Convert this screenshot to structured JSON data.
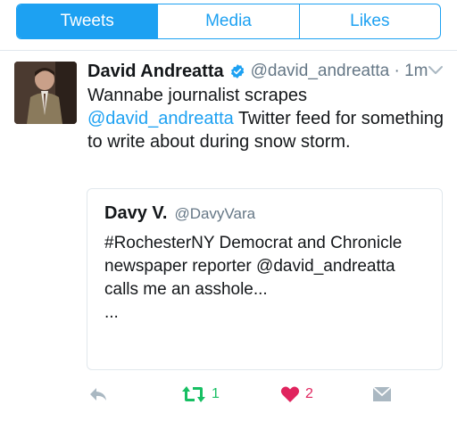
{
  "tabs": [
    {
      "label": "Tweets",
      "active": true
    },
    {
      "label": "Media",
      "active": false
    },
    {
      "label": "Likes",
      "active": false
    }
  ],
  "tweet": {
    "author_name": "David Andreatta",
    "verified": true,
    "handle_time": "@david_andreatta · 1m",
    "text_before": "Wannabe journalist scrapes ",
    "text_mention": "@david_andreatta",
    "text_after": " Twitter feed for something to write about during snow storm."
  },
  "quoted": {
    "name": "Davy V.",
    "handle": "@DavyVara",
    "text": "#RochesterNY Democrat and Chronicle newspaper reporter @david_andreatta calls me an asshole...",
    "ellipsis": "..."
  },
  "actions": {
    "retweet_count": "1",
    "like_count": "2"
  },
  "colors": {
    "accent": "#1da1f2",
    "retweet": "#17bf63",
    "like": "#e0245e",
    "muted": "#aab8c2"
  },
  "icons": [
    "verified-badge-icon",
    "chevron-down-icon",
    "reply-icon",
    "retweet-icon",
    "heart-icon",
    "direct-message-icon"
  ]
}
